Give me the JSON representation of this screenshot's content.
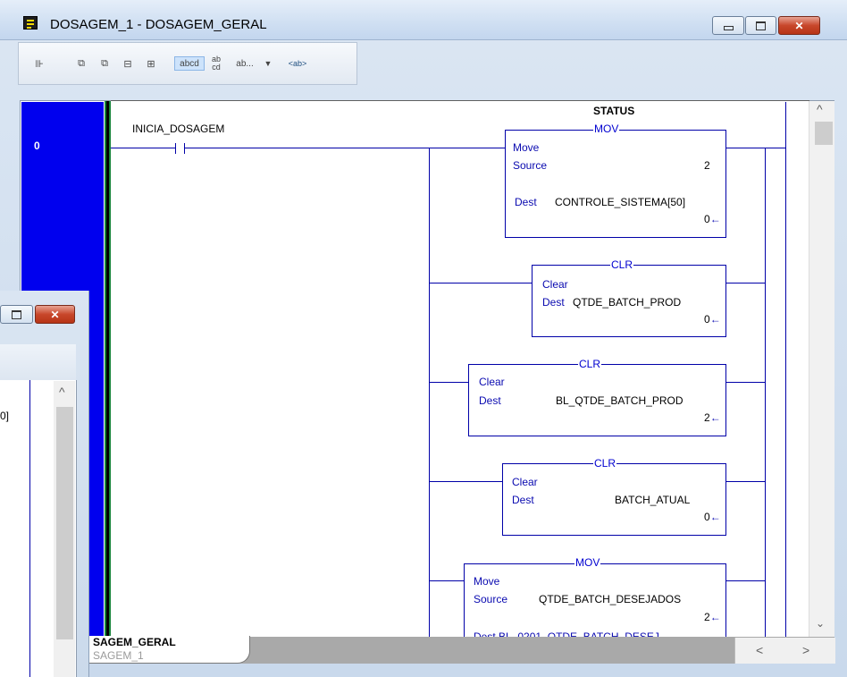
{
  "window": {
    "title": "DOSAGEM_1 - DOSAGEM_GERAL",
    "minimize_icon": "minimize-icon",
    "maximize_icon": "maximize-icon",
    "close_icon": "close-icon"
  },
  "toolbar": {
    "items": [
      "ladder-icon",
      "rung-icon",
      "rung-icon",
      "branch-icon",
      "branch-icon",
      "abcd",
      "ab cd",
      "ab...",
      "<ab>"
    ],
    "abcd": "abcd",
    "ab_top": "ab",
    "cd_bottom": "cd",
    "ab_dots": "ab...",
    "ab_tag": "<ab>"
  },
  "rung": {
    "number": "0",
    "contact_tag": "INICIA_DOSAGEM",
    "status_label": "STATUS"
  },
  "instructions": [
    {
      "type": "MOV",
      "line1": "Move",
      "line2_key": "Source",
      "line2_val": "2",
      "dest_key": "Dest",
      "dest_val": "CONTROLE_SISTEMA[50]",
      "value": "0"
    },
    {
      "type": "CLR",
      "line1": "Clear",
      "dest_key": "Dest",
      "dest_val": "QTDE_BATCH_PROD",
      "value": "0"
    },
    {
      "type": "CLR",
      "line1": "Clear",
      "dest_key": "Dest",
      "dest_val": "BL_QTDE_BATCH_PROD",
      "value": "2"
    },
    {
      "type": "CLR",
      "line1": "Clear",
      "dest_key": "Dest",
      "dest_val": "BATCH_ATUAL",
      "value": "0"
    },
    {
      "type": "MOV",
      "line1": "Move",
      "line2_key": "Source",
      "line2_val": "QTDE_BATCH_DESEJADOS",
      "source_value": "2",
      "dest_partial": "Dest   BL_0201_QTDE_BATCH_DESEJ"
    }
  ],
  "tabs": {
    "active_title": "SAGEM_GERAL",
    "active_sub": "SAGEM_1"
  },
  "back_window": {
    "partial_text": "0]"
  },
  "colors": {
    "rung_bar": "#0000ee",
    "rail": "#17853a",
    "ladder": "#0000a8"
  }
}
